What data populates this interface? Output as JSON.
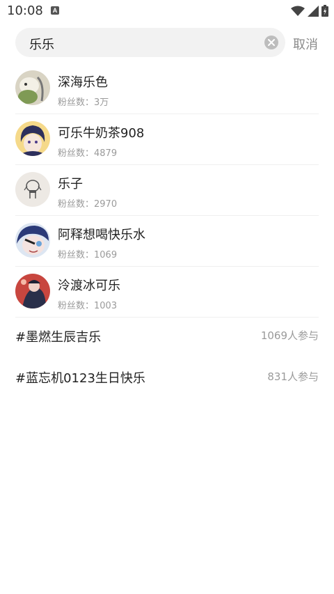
{
  "status": {
    "time": "10:08",
    "notif_letter": "A"
  },
  "search": {
    "query": "乐乐",
    "cancel_label": "取消"
  },
  "users": [
    {
      "name": "深海乐色",
      "fans_label": "粉丝数：",
      "fans": "3万"
    },
    {
      "name": "可乐牛奶茶908",
      "fans_label": "粉丝数：",
      "fans": "4879"
    },
    {
      "name": "乐子",
      "fans_label": "粉丝数：",
      "fans": "2970"
    },
    {
      "name": "阿释想喝快乐水",
      "fans_label": "粉丝数：",
      "fans": "1069"
    },
    {
      "name": "泠渡冰可乐",
      "fans_label": "粉丝数：",
      "fans": "1003"
    }
  ],
  "topics": [
    {
      "title": "#墨燃生辰吉乐",
      "count": "1069人参与"
    },
    {
      "title": "#蓝忘机0123生日快乐",
      "count": "831人参与"
    }
  ],
  "colors": {
    "secondary_text": "#9a9a9a",
    "search_bg": "#f2f2f2",
    "divider": "#efefef"
  }
}
